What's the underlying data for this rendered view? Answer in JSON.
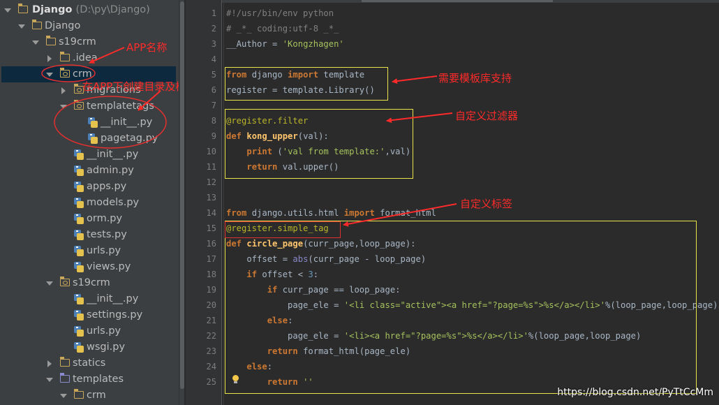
{
  "tree": [
    {
      "key": "django_root",
      "label": "Django",
      "path": "(D:\\py\\Django)",
      "bold": true
    },
    {
      "key": "django_pkg",
      "label": "Django"
    },
    {
      "key": "s19crm",
      "label": "s19crm"
    },
    {
      "key": "idea",
      "label": ".idea"
    },
    {
      "key": "crm",
      "label": "crm",
      "selected": true
    },
    {
      "key": "migrations",
      "label": "migrations"
    },
    {
      "key": "templatetags",
      "label": "templatetags"
    },
    {
      "key": "tt_init",
      "label": "__init__.py"
    },
    {
      "key": "pagetag",
      "label": "pagetag.py"
    },
    {
      "key": "crm_init",
      "label": "__init__.py"
    },
    {
      "key": "admin",
      "label": "admin.py"
    },
    {
      "key": "apps",
      "label": "apps.py"
    },
    {
      "key": "models",
      "label": "models.py"
    },
    {
      "key": "orm",
      "label": "orm.py"
    },
    {
      "key": "tests",
      "label": "tests.py"
    },
    {
      "key": "urls",
      "label": "urls.py"
    },
    {
      "key": "views",
      "label": "views.py"
    },
    {
      "key": "s19crm_pkg",
      "label": "s19crm"
    },
    {
      "key": "s19_init",
      "label": "__init__.py"
    },
    {
      "key": "settings",
      "label": "settings.py"
    },
    {
      "key": "s19_urls",
      "label": "urls.py"
    },
    {
      "key": "wsgi",
      "label": "wsgi.py"
    },
    {
      "key": "statics",
      "label": "statics"
    },
    {
      "key": "templates",
      "label": "templates"
    },
    {
      "key": "tmpl_crm",
      "label": "crm"
    }
  ],
  "line_numbers": [
    "1",
    "2",
    "3",
    "4",
    "5",
    "6",
    "7",
    "8",
    "9",
    "10",
    "11",
    "12",
    "13",
    "14",
    "15",
    "16",
    "17",
    "18",
    "19",
    "20",
    "21",
    "22",
    "23",
    "24",
    "25"
  ],
  "code": [
    [
      {
        "t": "#!/usr/bin/env python",
        "c": "cmt"
      }
    ],
    [
      {
        "t": "# _*_ coding:utf-8 _*_",
        "c": "cmt"
      }
    ],
    [
      {
        "t": "__Author = ",
        "c": "id"
      },
      {
        "t": "'Kongzhagen'",
        "c": "str"
      }
    ],
    [],
    [
      {
        "t": "from",
        "c": "kw"
      },
      {
        "t": " django ",
        "c": "id"
      },
      {
        "t": "import",
        "c": "kw"
      },
      {
        "t": " template",
        "c": "id"
      }
    ],
    [
      {
        "t": "register = template.Library()",
        "c": "id"
      }
    ],
    [],
    [
      {
        "t": "@register.filter",
        "c": "dec"
      }
    ],
    [
      {
        "t": "def",
        "c": "kw"
      },
      {
        "t": " ",
        "c": "id"
      },
      {
        "t": "kong_upper",
        "c": "fn"
      },
      {
        "t": "(val):",
        "c": "id"
      }
    ],
    [
      {
        "t": "    ",
        "c": "id"
      },
      {
        "t": "print",
        "c": "kw"
      },
      {
        "t": " (",
        "c": "id"
      },
      {
        "t": "'val from template:'",
        "c": "str"
      },
      {
        "t": ",val)",
        "c": "id"
      }
    ],
    [
      {
        "t": "    ",
        "c": "id"
      },
      {
        "t": "return",
        "c": "kw"
      },
      {
        "t": " val.upper()",
        "c": "id"
      }
    ],
    [],
    [],
    [
      {
        "t": "from",
        "c": "kw"
      },
      {
        "t": " django.utils.html ",
        "c": "id"
      },
      {
        "t": "import",
        "c": "kw"
      },
      {
        "t": " format_html",
        "c": "id"
      }
    ],
    [
      {
        "t": "@register.simple_tag",
        "c": "dec"
      }
    ],
    [
      {
        "t": "def",
        "c": "kw"
      },
      {
        "t": " ",
        "c": "id"
      },
      {
        "t": "circle_page",
        "c": "fn"
      },
      {
        "t": "(curr_page,loop_page):",
        "c": "id"
      }
    ],
    [
      {
        "t": "    offset = ",
        "c": "id"
      },
      {
        "t": "abs",
        "c": "bi"
      },
      {
        "t": "(curr_page - loop_page)",
        "c": "id"
      }
    ],
    [
      {
        "t": "    ",
        "c": "id"
      },
      {
        "t": "if",
        "c": "kw"
      },
      {
        "t": " offset < ",
        "c": "id"
      },
      {
        "t": "3",
        "c": "num"
      },
      {
        "t": ":",
        "c": "id"
      }
    ],
    [
      {
        "t": "        ",
        "c": "id"
      },
      {
        "t": "if",
        "c": "kw"
      },
      {
        "t": " curr_page == loop_page:",
        "c": "id"
      }
    ],
    [
      {
        "t": "            page_ele = ",
        "c": "id"
      },
      {
        "t": "'<li class=\"active\"><a href=\"?page=%s\">%s</a></li>'",
        "c": "str"
      },
      {
        "t": "%(loop_page,loop_page)",
        "c": "id"
      }
    ],
    [
      {
        "t": "        ",
        "c": "id"
      },
      {
        "t": "else",
        "c": "kw"
      },
      {
        "t": ":",
        "c": "id"
      }
    ],
    [
      {
        "t": "            page_ele = ",
        "c": "id"
      },
      {
        "t": "'<li><a href=\"?page=%s\">%s</a></li>'",
        "c": "str"
      },
      {
        "t": "%(loop_page,loop_page)",
        "c": "id"
      }
    ],
    [
      {
        "t": "        ",
        "c": "id"
      },
      {
        "t": "return",
        "c": "kw"
      },
      {
        "t": " format_html(page_ele)",
        "c": "id"
      }
    ],
    [
      {
        "t": "    ",
        "c": "id"
      },
      {
        "t": "else",
        "c": "kw"
      },
      {
        "t": ":",
        "c": "id"
      }
    ],
    [
      {
        "t": "        ",
        "c": "id"
      },
      {
        "t": "return",
        "c": "kw"
      },
      {
        "t": " ",
        "c": "id"
      },
      {
        "t": "''",
        "c": "str"
      }
    ]
  ],
  "colors": {
    "kw": "#cc7832",
    "str": "#a5c25c",
    "cmt": "#808080",
    "dec": "#bbb529",
    "fn": "#ffc66d",
    "bi": "#8888c6",
    "num": "#6897bb",
    "id": "#a9b7c6"
  },
  "annotations": {
    "app_name": "APP名称",
    "create_dir": "在APP下创建目录及模块名",
    "need_lib": "需要模板库支持",
    "custom_filter": "自定义过滤器",
    "custom_tag": "自定义标签"
  },
  "watermark": "https://blog.csdn.net/PyTtCcMm"
}
